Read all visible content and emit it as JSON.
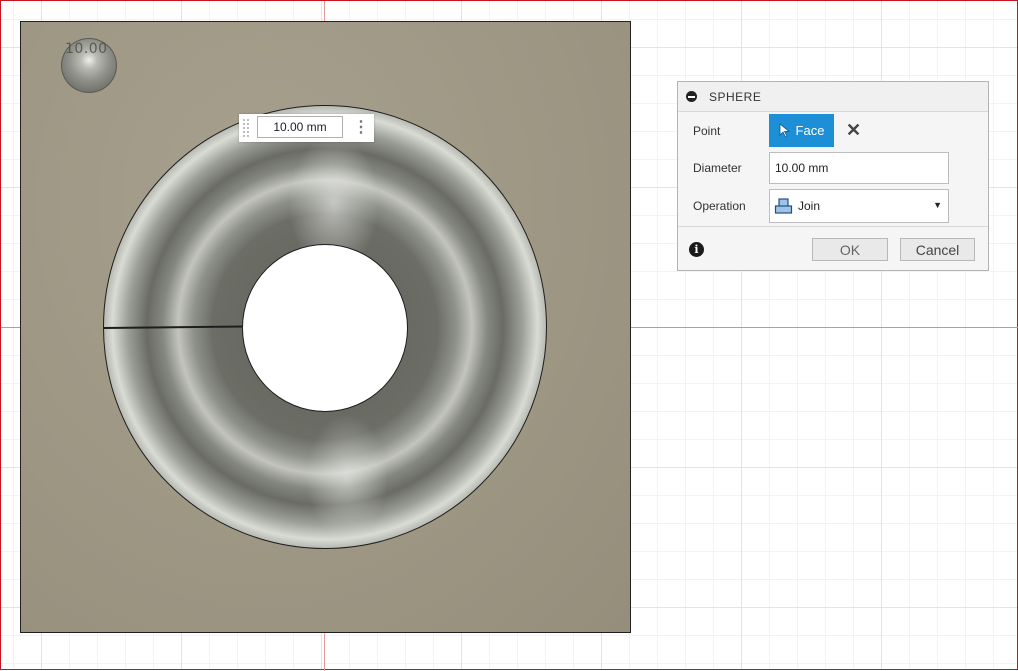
{
  "canvas": {
    "preview_sphere_label": "10.00",
    "dimension_input": {
      "value": "10.00 mm"
    }
  },
  "dialog": {
    "title": "SPHERE",
    "point": {
      "label": "Point",
      "selection_label": "Face",
      "clear_icon": "close-icon"
    },
    "diameter": {
      "label": "Diameter",
      "value": "10.00 mm"
    },
    "operation": {
      "label": "Operation",
      "selected": "Join"
    },
    "buttons": {
      "ok": "OK",
      "cancel": "Cancel"
    },
    "info_icon": "i"
  },
  "colors": {
    "accent": "#1c8fd6",
    "plate": "#9d9683",
    "viewport_border": "#c8141e"
  }
}
